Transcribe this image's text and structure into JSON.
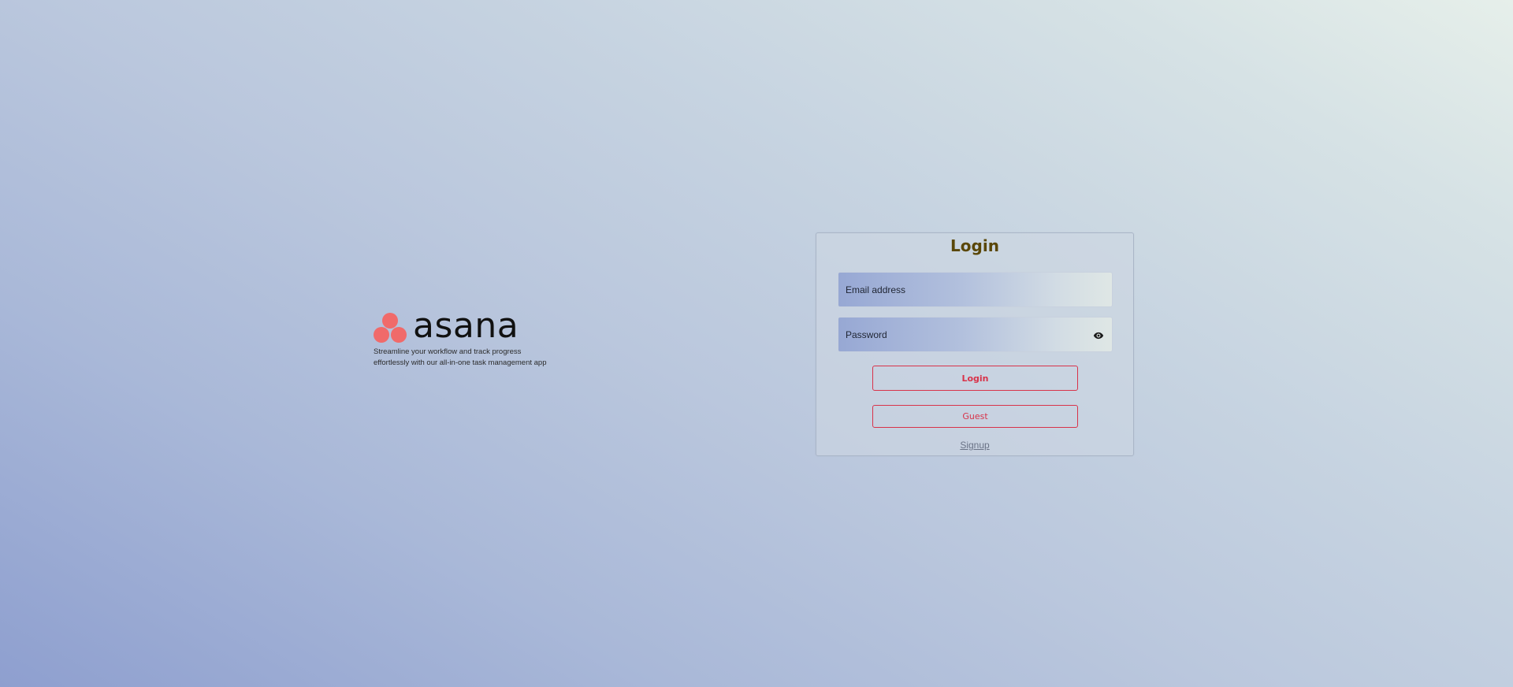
{
  "brand": {
    "name": "asana",
    "tagline": "Streamline your workflow and track progress effortlessly with our all-in-one task management app",
    "logo_color": "#f06a6a"
  },
  "login": {
    "title": "Login",
    "email_placeholder": "Email address",
    "password_placeholder": "Password",
    "password_toggle_icon": "eye-icon",
    "login_button": "Login",
    "guest_button": "Guest",
    "signup_link": "Signup",
    "accent_color": "#d8334a",
    "title_color": "#5a4708"
  }
}
